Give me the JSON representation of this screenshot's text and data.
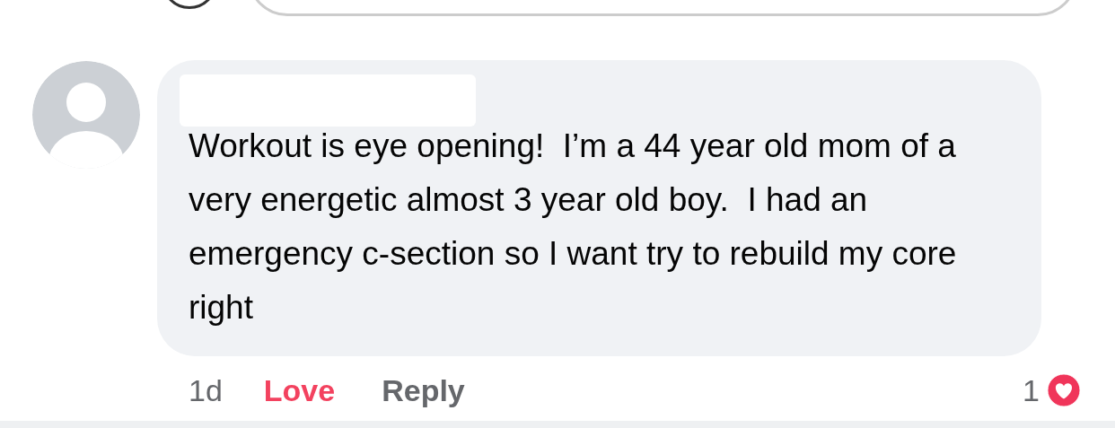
{
  "comment": {
    "text": "Workout is eye opening!  I’m a 44 year old mom of a very energetic almost 3 year old boy.  I had an emergency c-section so I want try to rebuild my core right",
    "author_redacted": true,
    "time": "1d",
    "reaction": {
      "label": "Love",
      "selected": true
    },
    "reply": "Reply",
    "reaction_count": "1"
  }
}
